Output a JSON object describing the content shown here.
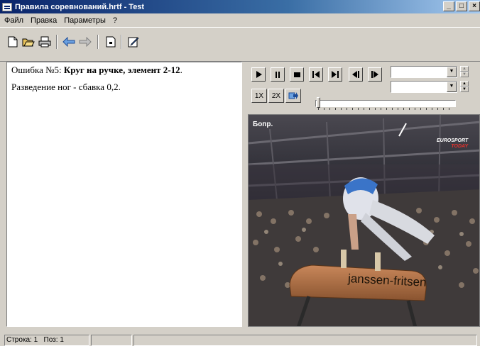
{
  "window": {
    "title": "Правила соревнований.hrtf - Test",
    "controls": {
      "minimize": "_",
      "maximize": "□",
      "close": "×"
    }
  },
  "menu": [
    "Файл",
    "Правка",
    "Параметры",
    "?"
  ],
  "toolbar": {
    "icons": [
      "new-document-icon",
      "open-folder-icon",
      "print-icon",
      "back-arrow-icon",
      "forward-arrow-icon",
      "page-icon",
      "edit-icon"
    ]
  },
  "editor": {
    "line1_prefix": "Ошибка №5: ",
    "line1_bold": "Круг на ручке, элемент 2-12",
    "line1_end": ".",
    "line2": "Разведение ног - сбавка 0,2."
  },
  "media": {
    "speed_1x": "1X",
    "speed_2x": "2X",
    "combo1_value": "",
    "combo2_value": "",
    "position_fraction": 0.0,
    "video": {
      "overlay_text": "Бопр.",
      "channel_logo_top": "EUROSPORT",
      "channel_logo_bottom": "TODAY",
      "brand_text": "janssen-fritsen"
    }
  },
  "status": {
    "line_label": "Строка:",
    "line_value": "1",
    "pos_label": "Поз:",
    "pos_value": "1"
  }
}
